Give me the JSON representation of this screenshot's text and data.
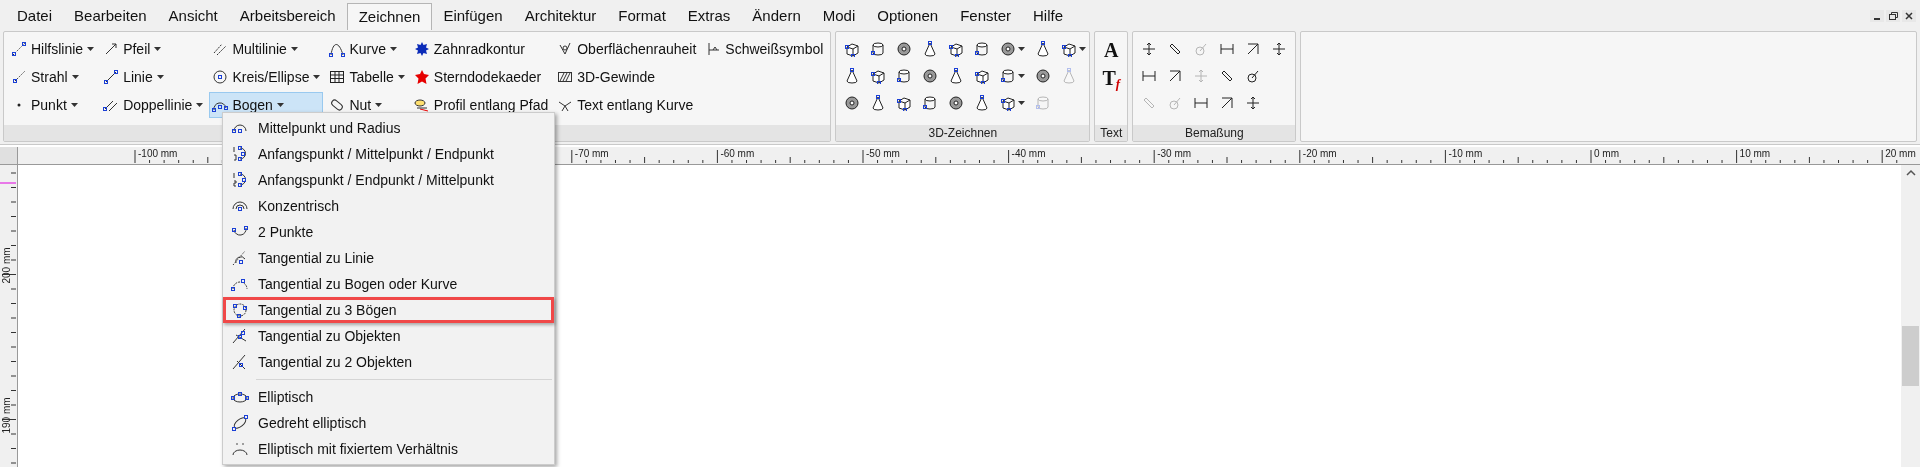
{
  "menu_bar": {
    "tabs": [
      {
        "label": "Datei",
        "selected": false
      },
      {
        "label": "Bearbeiten",
        "selected": false
      },
      {
        "label": "Ansicht",
        "selected": false
      },
      {
        "label": "Arbeitsbereich",
        "selected": false
      },
      {
        "label": "Zeichnen",
        "selected": true
      },
      {
        "label": "Einfügen",
        "selected": false
      },
      {
        "label": "Architektur",
        "selected": false
      },
      {
        "label": "Format",
        "selected": false
      },
      {
        "label": "Extras",
        "selected": false
      },
      {
        "label": "Ändern",
        "selected": false
      },
      {
        "label": "Modi",
        "selected": false
      },
      {
        "label": "Optionen",
        "selected": false
      },
      {
        "label": "Fenster",
        "selected": false
      },
      {
        "label": "Hilfe",
        "selected": false
      }
    ]
  },
  "ribbon": {
    "groups": [
      {
        "kind": "tools",
        "columns": [
          [
            {
              "label": "Hilfslinie",
              "dropdown": true,
              "selected": false
            },
            {
              "label": "Strahl",
              "dropdown": true,
              "selected": false
            },
            {
              "label": "Punkt",
              "dropdown": true,
              "selected": false
            }
          ],
          [
            {
              "label": "Pfeil",
              "dropdown": true,
              "selected": false
            },
            {
              "label": "Linie",
              "dropdown": true,
              "selected": false
            },
            {
              "label": "Doppellinie",
              "dropdown": true,
              "selected": false
            }
          ],
          [
            {
              "label": "Multilinie",
              "dropdown": true,
              "selected": false
            },
            {
              "label": "Kreis/Ellipse",
              "dropdown": true,
              "selected": false
            },
            {
              "label": "Bogen",
              "dropdown": true,
              "selected": true
            }
          ],
          [
            {
              "label": "Kurve",
              "dropdown": true,
              "selected": false
            },
            {
              "label": "Tabelle",
              "dropdown": true,
              "selected": false
            },
            {
              "label": "Nut",
              "dropdown": true,
              "selected": false
            }
          ],
          [
            {
              "label": "Zahnradkontur",
              "dropdown": false,
              "selected": false
            },
            {
              "label": "Sterndodekaeder",
              "dropdown": false,
              "selected": false
            },
            {
              "label": "Profil entlang Pfad",
              "dropdown": false,
              "selected": false
            }
          ],
          [
            {
              "label": "Oberflächenrauheit",
              "dropdown": false,
              "selected": false
            },
            {
              "label": "3D-Gewinde",
              "dropdown": false,
              "selected": false
            },
            {
              "label": "Text entlang Kurve",
              "dropdown": false,
              "selected": false
            }
          ],
          [
            {
              "label": "Schweißsymbol",
              "dropdown": false,
              "selected": false
            }
          ]
        ]
      },
      {
        "kind": "icons",
        "label": "3D-Zeichnen",
        "rows": [
          [
            {
              "dropdown": false,
              "disabled": false
            },
            {
              "dropdown": false,
              "disabled": false
            },
            {
              "dropdown": false,
              "disabled": false
            },
            {
              "dropdown": false,
              "disabled": false
            },
            {
              "dropdown": false,
              "disabled": false
            },
            {
              "dropdown": false,
              "disabled": false
            },
            {
              "dropdown": true,
              "disabled": false
            },
            {
              "dropdown": false,
              "disabled": false
            },
            {
              "dropdown": true,
              "disabled": false
            }
          ],
          [
            {
              "dropdown": false,
              "disabled": false
            },
            {
              "dropdown": false,
              "disabled": false
            },
            {
              "dropdown": false,
              "disabled": false
            },
            {
              "dropdown": false,
              "disabled": false
            },
            {
              "dropdown": false,
              "disabled": false
            },
            {
              "dropdown": false,
              "disabled": false
            },
            {
              "dropdown": true,
              "disabled": false
            },
            {
              "dropdown": false,
              "disabled": false
            },
            {
              "dropdown": false,
              "disabled": true
            }
          ],
          [
            {
              "dropdown": false,
              "disabled": false
            },
            {
              "dropdown": false,
              "disabled": false
            },
            {
              "dropdown": false,
              "disabled": false
            },
            {
              "dropdown": false,
              "disabled": false
            },
            {
              "dropdown": false,
              "disabled": false
            },
            {
              "dropdown": false,
              "disabled": false
            },
            {
              "dropdown": true,
              "disabled": false
            },
            {
              "dropdown": false,
              "disabled": true
            }
          ]
        ]
      },
      {
        "kind": "glyphs",
        "label": "Text",
        "items": [
          {
            "glyph": "A"
          },
          {
            "glyph": "T",
            "sub": "f"
          }
        ]
      },
      {
        "kind": "icons",
        "label": "Bemaßung",
        "rows": [
          [
            {
              "dropdown": false,
              "disabled": false
            },
            {
              "dropdown": false,
              "disabled": false
            },
            {
              "dropdown": false,
              "disabled": true
            },
            {
              "dropdown": false,
              "disabled": false
            },
            {
              "dropdown": false,
              "disabled": false
            },
            {
              "dropdown": false,
              "disabled": false
            }
          ],
          [
            {
              "dropdown": false,
              "disabled": false
            },
            {
              "dropdown": false,
              "disabled": false
            },
            {
              "dropdown": false,
              "disabled": true
            },
            {
              "dropdown": false,
              "disabled": false
            },
            {
              "dropdown": false,
              "disabled": false
            }
          ],
          [
            {
              "dropdown": false,
              "disabled": true
            },
            {
              "dropdown": false,
              "disabled": true
            },
            {
              "dropdown": false,
              "disabled": false
            },
            {
              "dropdown": false,
              "disabled": false
            },
            {
              "dropdown": false,
              "disabled": false
            }
          ]
        ]
      }
    ]
  },
  "dropdown_menu": {
    "items": [
      {
        "kind": "item",
        "label": "Mittelpunkt und Radius",
        "highlighted": false
      },
      {
        "kind": "item",
        "label": "Anfangspunkt / Mittelpunkt / Endpunkt",
        "highlighted": false
      },
      {
        "kind": "item",
        "label": "Anfangspunkt / Endpunkt / Mittelpunkt",
        "highlighted": false
      },
      {
        "kind": "item",
        "label": "Konzentrisch",
        "highlighted": false
      },
      {
        "kind": "item",
        "label": "2 Punkte",
        "highlighted": false
      },
      {
        "kind": "item",
        "label": "Tangential zu Linie",
        "highlighted": false
      },
      {
        "kind": "item",
        "label": "Tangential zu Bogen oder Kurve",
        "highlighted": false
      },
      {
        "kind": "item",
        "label": "Tangential zu 3 Bögen",
        "highlighted": true
      },
      {
        "kind": "item",
        "label": "Tangential zu Objekten",
        "highlighted": false
      },
      {
        "kind": "item",
        "label": "Tangential zu 2 Objekten",
        "highlighted": false
      },
      {
        "kind": "separator"
      },
      {
        "kind": "item",
        "label": "Elliptisch",
        "highlighted": false
      },
      {
        "kind": "item",
        "label": "Gedreht elliptisch",
        "highlighted": false
      },
      {
        "kind": "item",
        "label": "Elliptisch mit fixiertem Verhältnis",
        "highlighted": false
      }
    ]
  },
  "ruler": {
    "labels": [
      "-100 mm",
      "-70 mm",
      "-60 mm",
      "-50 mm",
      "-40 mm",
      "-30 mm",
      "-20 mm",
      "-10 mm",
      "0 mm",
      "10 mm",
      "20 mm"
    ]
  },
  "vertical_ruler": {
    "labels": [
      "200 mm",
      "190 mm"
    ]
  }
}
